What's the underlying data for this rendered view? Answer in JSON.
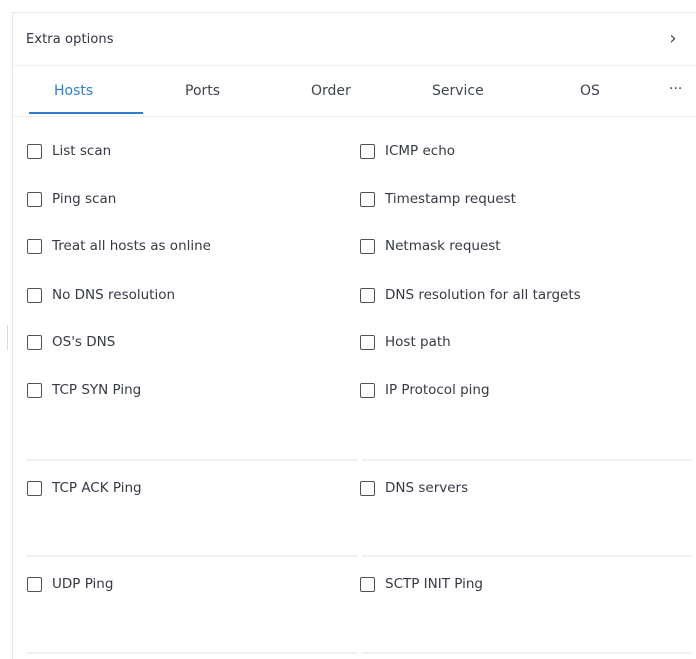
{
  "header": {
    "title": "Extra options",
    "chevron": "›"
  },
  "tabs": [
    {
      "label": "Hosts",
      "active": true
    },
    {
      "label": "Ports"
    },
    {
      "label": "Order"
    },
    {
      "label": "Service"
    },
    {
      "label": "OS"
    },
    {
      "label": "···"
    }
  ],
  "options": {
    "left": [
      "List scan",
      "Ping scan",
      "Treat all hosts as online",
      "No DNS resolution",
      "OS's DNS",
      "TCP SYN Ping",
      "TCP ACK Ping",
      "UDP Ping"
    ],
    "right": [
      "ICMP echo",
      "Timestamp request",
      "Netmask request",
      "DNS resolution for all targets",
      "Host path",
      "IP Protocol ping",
      "DNS servers",
      "SCTP INIT Ping"
    ]
  },
  "colors": {
    "accent": "#2a7fd4",
    "text": "#343945",
    "divider": "#eceef1"
  }
}
